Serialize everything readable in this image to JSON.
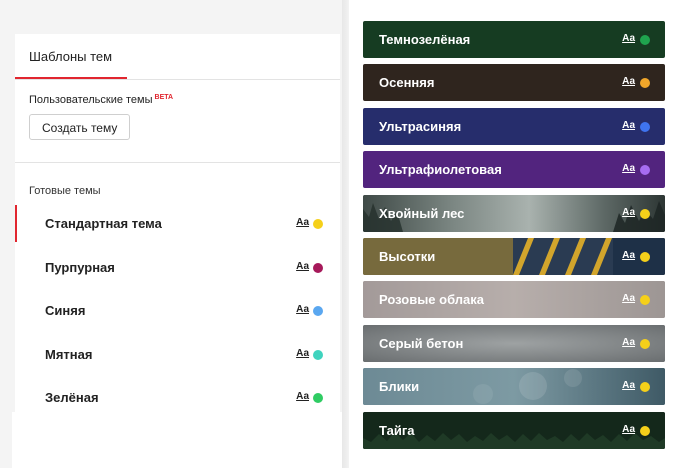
{
  "tabs": {
    "active_label": "Шаблоны тем"
  },
  "custom_section": {
    "title": "Пользовательские темы",
    "beta_badge": "BETA",
    "create_button": "Создать тему"
  },
  "ready_section": {
    "title": "Готовые темы",
    "aa_label": "Аа",
    "items": [
      {
        "label": "Стандартная тема",
        "dot_color": "#f5d01a",
        "selected": true
      },
      {
        "label": "Пурпурная",
        "dot_color": "#a6195a"
      },
      {
        "label": "Синяя",
        "dot_color": "#5aa7f0"
      },
      {
        "label": "Мятная",
        "dot_color": "#3fd3be"
      },
      {
        "label": "Зелёная",
        "dot_color": "#2fcc63"
      }
    ]
  },
  "theme_cards": {
    "aa_label": "Аа",
    "items": [
      {
        "label": "Темнозелёная",
        "bg": "#163c22",
        "dot_color": "#1fa34e"
      },
      {
        "label": "Осенняя",
        "bg": "#2f251e",
        "dot_color": "#f0a62a"
      },
      {
        "label": "Ультрасиняя",
        "bg": "#262d6c",
        "dot_color": "#3f74f0"
      },
      {
        "label": "Ультрафиолетовая",
        "bg": "#52247e",
        "dot_color": "#a66df0"
      },
      {
        "label": "Хвойный лес",
        "bg": "#4a5552",
        "dot_color": "#f5d01a"
      },
      {
        "label": "Высотки",
        "bg": "#7a6a3a",
        "dot_color": "#f5d01a"
      },
      {
        "label": "Розовые облака",
        "bg": "#a09a98",
        "dot_color": "#f5d01a"
      },
      {
        "label": "Серый бетон",
        "bg": "#7d8183",
        "dot_color": "#f5d01a"
      },
      {
        "label": "Блики",
        "bg": "#5d7a86",
        "dot_color": "#f5d01a"
      },
      {
        "label": "Тайга",
        "bg": "#14281b",
        "dot_color": "#f5d01a"
      }
    ]
  }
}
